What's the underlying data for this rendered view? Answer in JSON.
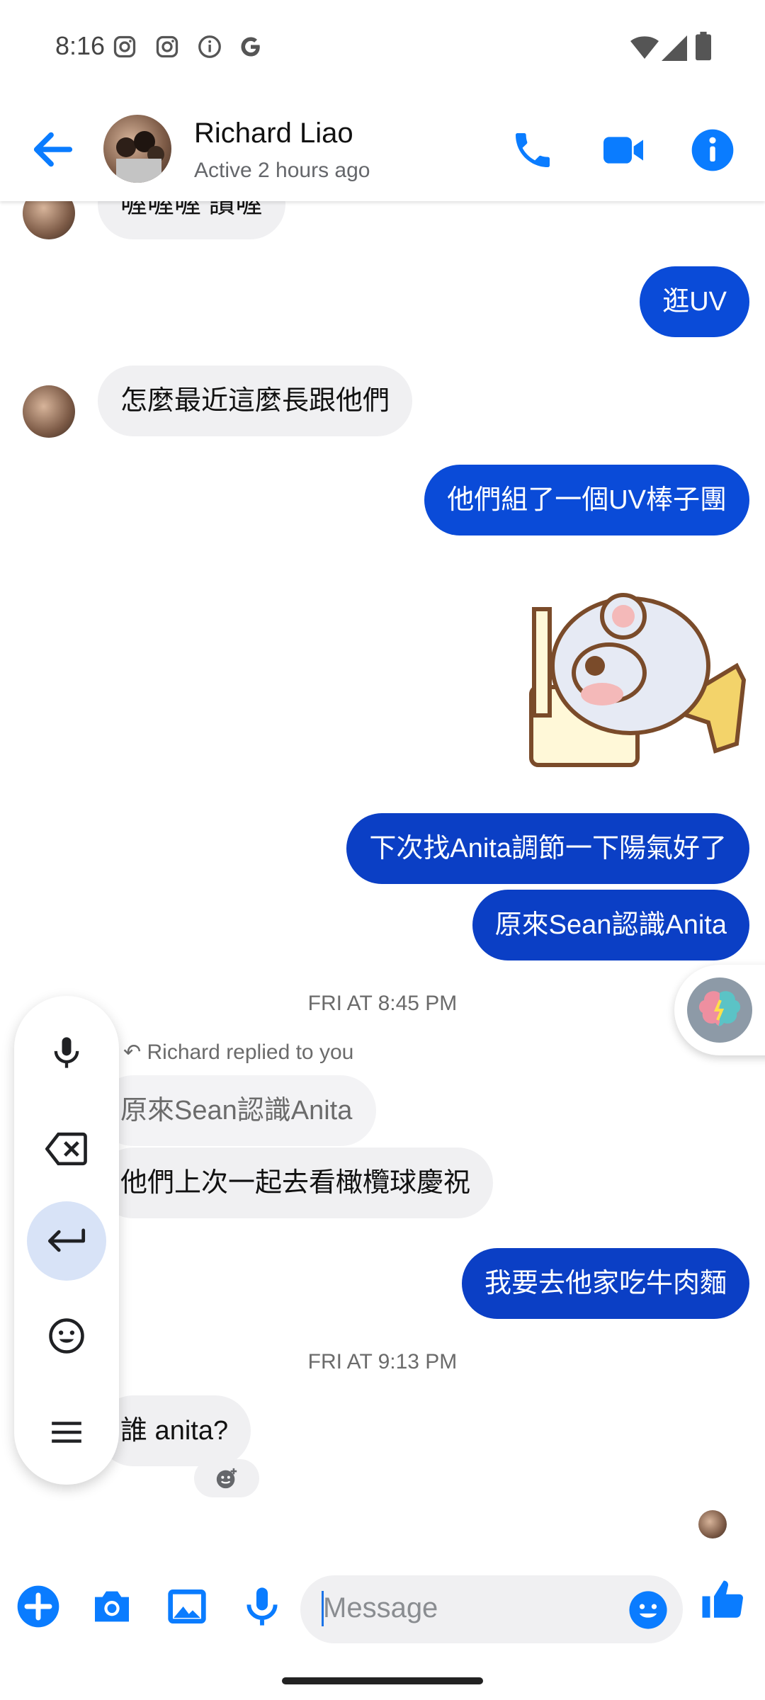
{
  "status_bar": {
    "time": "8:16"
  },
  "header": {
    "contact_name": "Richard Liao",
    "contact_status": "Active 2 hours ago"
  },
  "messages": [
    {
      "id": "m0",
      "dir": "in",
      "text": "喔喔喔 讚喔"
    },
    {
      "id": "m1",
      "dir": "out",
      "text": "逛UV"
    },
    {
      "id": "m2",
      "dir": "in",
      "text": "怎麼最近這麼長跟他們"
    },
    {
      "id": "m3",
      "dir": "out",
      "text": "他們組了一個UV棒子團"
    },
    {
      "id": "m4",
      "dir": "out",
      "text": "下次找Anita調節一下陽氣好了"
    },
    {
      "id": "m5",
      "dir": "out",
      "text": "原來Sean認識Anita"
    },
    {
      "id": "m6",
      "dir": "in",
      "reply_quote": "原來Sean認識Anita",
      "text": "他們上次一起去看橄欖球慶祝"
    },
    {
      "id": "m7",
      "dir": "out",
      "text": "我要去他家吃牛肉麵"
    },
    {
      "id": "m8",
      "dir": "in",
      "text": "誰 anita?"
    }
  ],
  "timestamps": [
    "FRI AT 8:45 PM",
    "FRI AT 9:13 PM"
  ],
  "reply_note": "Richard replied to you",
  "composer": {
    "placeholder": "Message"
  },
  "icons": {
    "header": [
      "back-arrow-icon",
      "phone-icon",
      "video-camera-icon",
      "info-icon"
    ],
    "tool_panel": [
      "microphone-icon",
      "backspace-icon",
      "enter-icon",
      "emoji-icon",
      "menu-icon"
    ],
    "composer": [
      "plus-icon",
      "camera-icon",
      "gallery-icon",
      "microphone-icon",
      "emoji-icon",
      "thumbs-up-icon"
    ]
  },
  "colors": {
    "accent": "#0a7cff",
    "outgoing_bubble": "#0a4bd8",
    "incoming_bubble": "#f0f0f2"
  }
}
